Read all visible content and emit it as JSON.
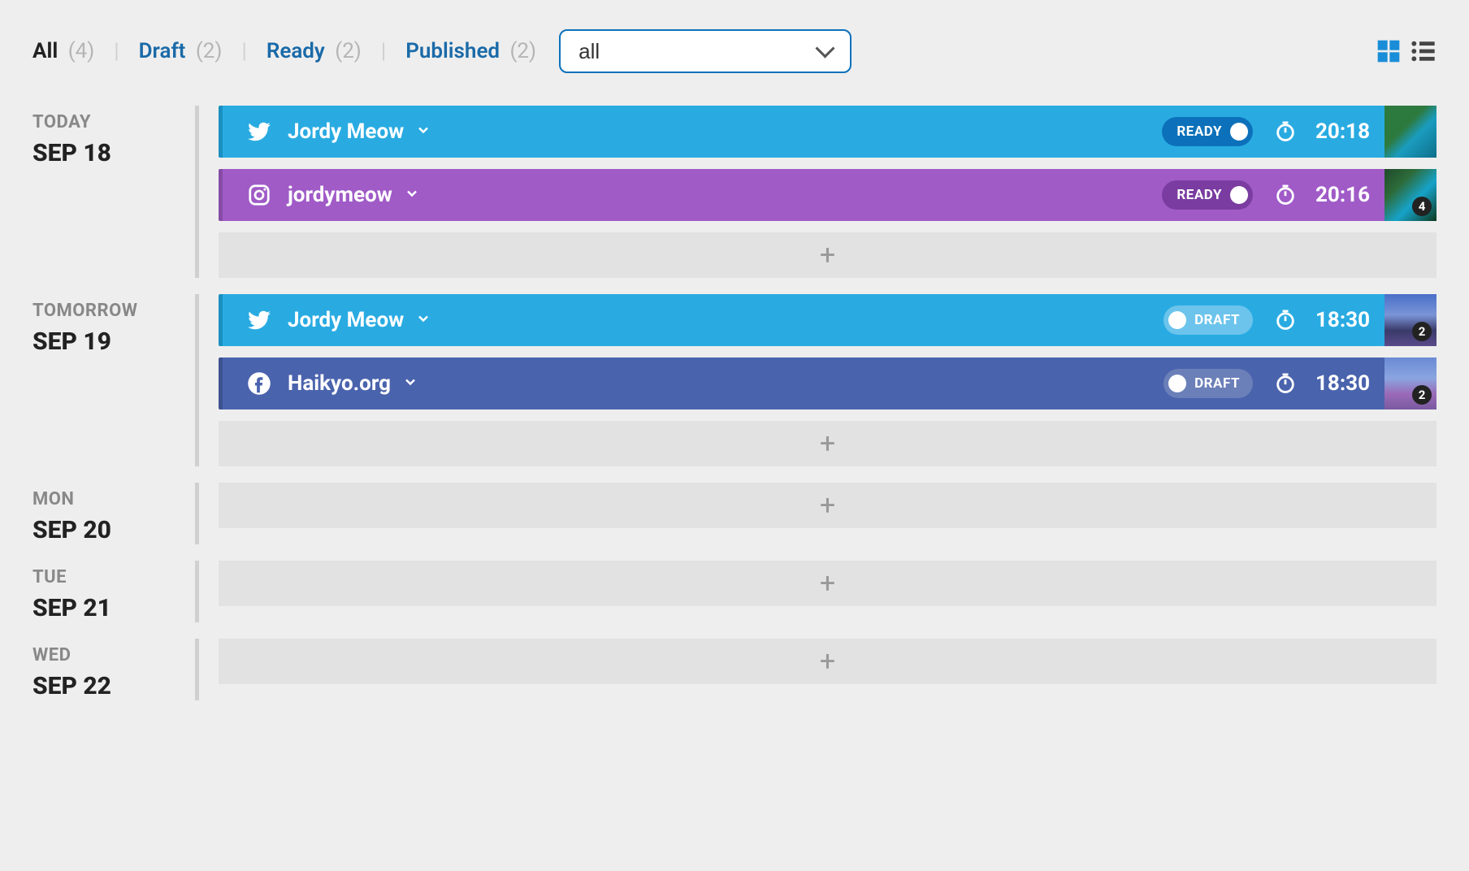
{
  "filters": {
    "tabs": [
      {
        "label": "All",
        "count": "(4)",
        "active": true
      },
      {
        "label": "Draft",
        "count": "(2)",
        "active": false
      },
      {
        "label": "Ready",
        "count": "(2)",
        "active": false
      },
      {
        "label": "Published",
        "count": "(2)",
        "active": false
      }
    ],
    "select_value": "all"
  },
  "status_labels": {
    "ready": "READY",
    "draft": "DRAFT"
  },
  "days": [
    {
      "top": "TODAY",
      "bot": "SEP 18",
      "posts": [
        {
          "platform": "twitter",
          "account": "Jordy Meow",
          "status": "ready",
          "time": "20:18",
          "thumb": "t1",
          "badge": null
        },
        {
          "platform": "instagram",
          "account": "jordymeow",
          "status": "ready",
          "time": "20:16",
          "thumb": "t2",
          "badge": "4"
        }
      ],
      "has_add": true
    },
    {
      "top": "TOMORROW",
      "bot": "SEP 19",
      "posts": [
        {
          "platform": "twitter",
          "account": "Jordy Meow",
          "status": "draft",
          "time": "18:30",
          "thumb": "t3",
          "badge": "2"
        },
        {
          "platform": "facebook",
          "account": "Haikyo.org",
          "status": "draft",
          "time": "18:30",
          "thumb": "t4",
          "badge": "2"
        }
      ],
      "has_add": true
    },
    {
      "top": "MON",
      "bot": "SEP 20",
      "posts": [],
      "has_add": true
    },
    {
      "top": "TUE",
      "bot": "SEP 21",
      "posts": [],
      "has_add": true
    },
    {
      "top": "WED",
      "bot": "SEP 22",
      "posts": [],
      "has_add": true
    }
  ]
}
